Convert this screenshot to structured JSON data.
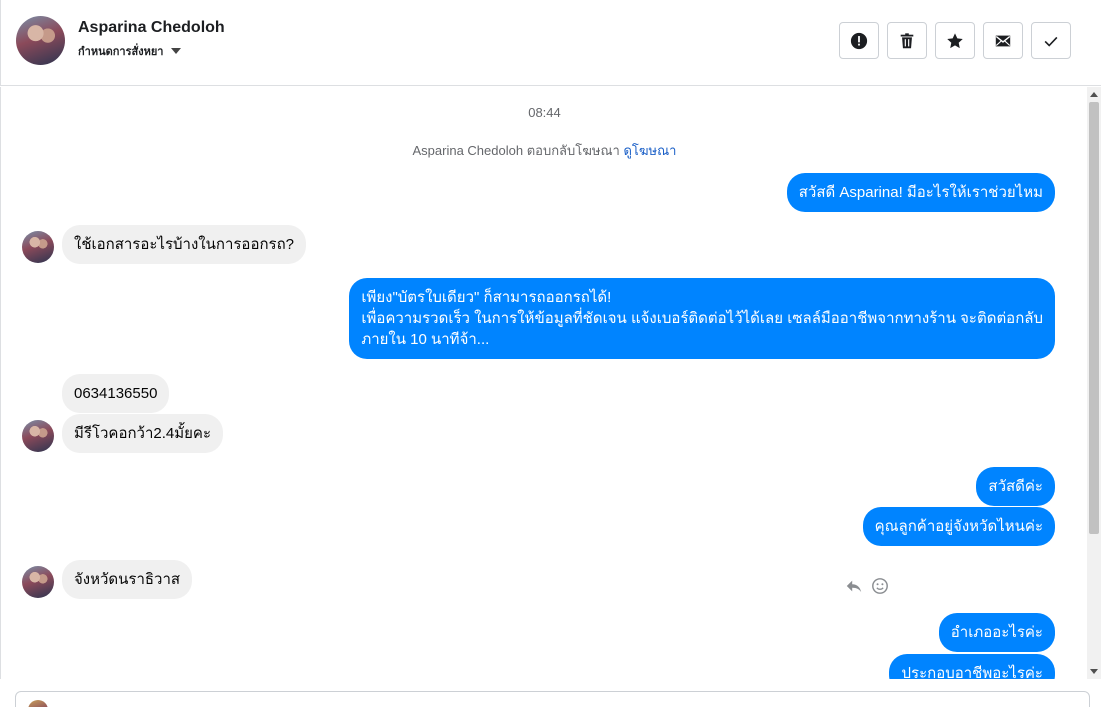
{
  "contact": {
    "name": "Asparina Chedoloh",
    "stage": "กำหนดการสั่งหยา"
  },
  "toolbar": {
    "icons": [
      "alert-icon",
      "trash-icon",
      "star-icon",
      "envelope-icon",
      "check-icon"
    ]
  },
  "thread": {
    "timestamp": "08:44",
    "system_text": "Asparina Chedoloh ตอบกลับโฆษณา",
    "system_link": "ดูโฆษณา",
    "messages": [
      {
        "from": "page",
        "text": "สวัสดี Asparina! มีอะไรให้เราช่วยไหม"
      },
      {
        "from": "customer",
        "text": "ใช้เอกสารอะไรบ้างในการออกรถ?"
      },
      {
        "from": "page",
        "lines": [
          "เพียง\"บัตรใบเดียว\" ก็สามารถออกรถได้!",
          "เพื่อความรวดเร็ว ในการให้ข้อมูลที่ชัดเจน แจ้งเบอร์ติดต่อไว้ได้เลย เซลล์มืออาชีพจากทางร้าน จะติดต่อกลับ",
          "ภายใน 10 นาทีจ้า..."
        ]
      },
      {
        "from": "customer",
        "text": "0634136550"
      },
      {
        "from": "customer",
        "text": "มีรีโวคอกว้า2.4มั้ยคะ"
      },
      {
        "from": "page",
        "text": "สวัสดีค่ะ"
      },
      {
        "from": "page",
        "text": "คุณลูกค้าอยู่จังหวัดไหนค่ะ"
      },
      {
        "from": "customer",
        "text": "จังหวัดนราธิวาส"
      },
      {
        "from": "page",
        "text": "อำเภออะไรค่ะ"
      },
      {
        "from": "page",
        "text": "ประกอบอาชีพอะไรค่ะ"
      }
    ]
  },
  "colors": {
    "outgoing_bubble": "#0084ff",
    "incoming_bubble": "#f0f0f0",
    "link": "#1a5fc7"
  }
}
